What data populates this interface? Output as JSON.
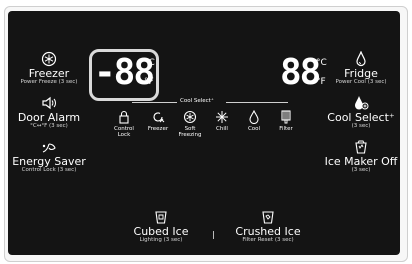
{
  "left": {
    "freezer": {
      "title": "Freezer",
      "sub": "Power Freeze (3 sec)"
    },
    "door_alarm": {
      "title": "Door Alarm",
      "sub": "°C↔°F (3 sec)"
    },
    "energy_saver": {
      "title": "Energy Saver",
      "sub": "Control Lock (3 sec)"
    }
  },
  "right": {
    "fridge": {
      "title": "Fridge",
      "sub": "Power Cool (3 sec)"
    },
    "cool_select": {
      "title": "Cool Select⁺",
      "sub": "(3 sec)"
    },
    "ice_maker": {
      "title": "Ice Maker Off",
      "sub": "(3 sec)"
    }
  },
  "display": {
    "freezer_digits": "-88",
    "fridge_digits": "88",
    "unit_c": "°C",
    "unit_f": "°F"
  },
  "cool_select": {
    "header": "Cool Select⁺",
    "items": [
      {
        "label": "Control\nLock",
        "icon": "lock-icon"
      },
      {
        "label": "Freezer",
        "icon": "freezer-mode-icon"
      },
      {
        "label": "Soft\nFreezing",
        "icon": "soft-freezing-icon"
      },
      {
        "label": "Chill",
        "icon": "chill-icon"
      },
      {
        "label": "Cool",
        "icon": "cool-icon"
      },
      {
        "label": "Filter",
        "icon": "filter-icon"
      }
    ]
  },
  "bottom": {
    "cubed": {
      "title": "Cubed Ice",
      "sub": "Lighting (3 sec)"
    },
    "crushed": {
      "title": "Crushed Ice",
      "sub": "Filter Reset (3 sec)"
    }
  },
  "colors": {
    "panel": "#141414",
    "text": "#ffffff",
    "highlight": "#d9d9d9"
  }
}
